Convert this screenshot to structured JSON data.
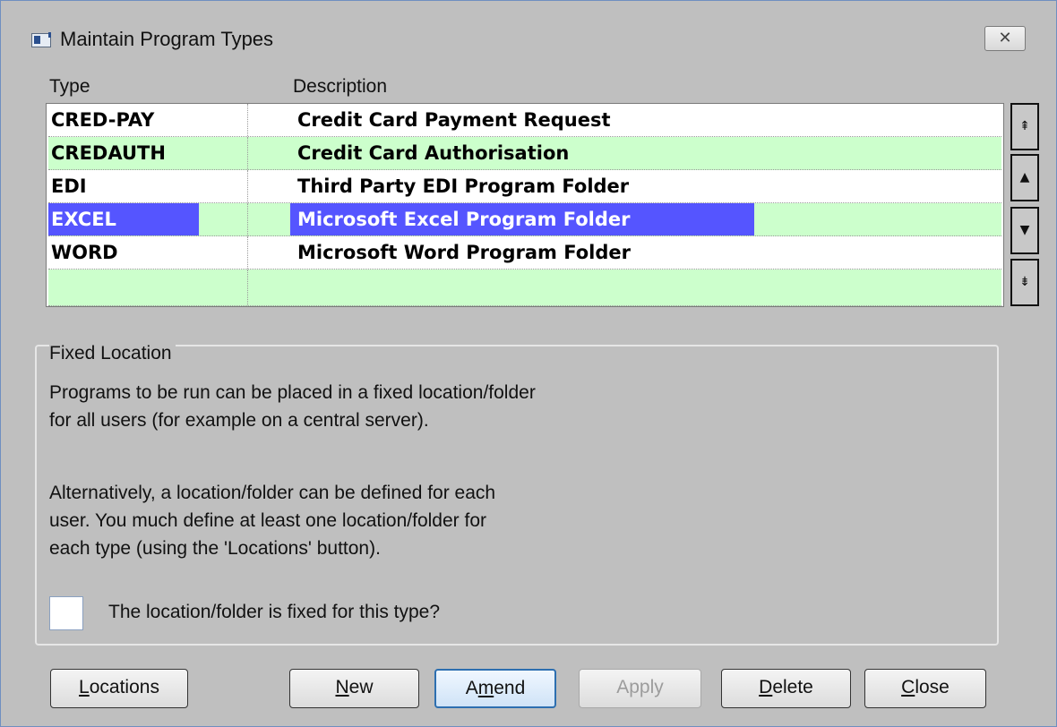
{
  "window": {
    "title": "Maintain Program Types",
    "close_glyph": "✕"
  },
  "list": {
    "headers": {
      "type": "Type",
      "description": "Description"
    },
    "rows": [
      {
        "type": "CRED-PAY",
        "description": "Credit Card Payment Request",
        "selected": false
      },
      {
        "type": "CREDAUTH",
        "description": "Credit Card Authorisation",
        "selected": false
      },
      {
        "type": "EDI",
        "description": "Third Party EDI Program Folder",
        "selected": false
      },
      {
        "type": "EXCEL",
        "description": "Microsoft Excel Program Folder",
        "selected": true
      },
      {
        "type": "WORD",
        "description": "Microsoft Word Program Folder",
        "selected": false
      },
      {
        "type": "",
        "description": "",
        "selected": false
      }
    ],
    "scroll": {
      "first": "⇞",
      "up": "▲",
      "down": "▼",
      "last": "⇟"
    }
  },
  "fixed_location": {
    "legend": "Fixed Location",
    "lines": [
      "Programs to be run  can be placed in a fixed location/folder",
      "for all users (for example on a central server).",
      "Alternatively, a location/folder can be defined for each",
      "user.  You much define at least one location/folder for",
      "each type (using the 'Locations' button)."
    ],
    "checkbox_label": "The location/folder is fixed for this type?",
    "checked": false
  },
  "buttons": {
    "locations": {
      "accel": "L",
      "rest": "ocations"
    },
    "new": {
      "accel": "N",
      "rest": "ew"
    },
    "amend": {
      "pre": "A",
      "accel": "m",
      "rest": "end"
    },
    "apply": {
      "label": "Apply"
    },
    "delete": {
      "accel": "D",
      "rest": "elete"
    },
    "close": {
      "accel": "C",
      "rest": "lose"
    }
  },
  "colors": {
    "row_alt": "#ccffcc",
    "selection": "#5555ff",
    "window_bg": "#bfbfbf"
  }
}
